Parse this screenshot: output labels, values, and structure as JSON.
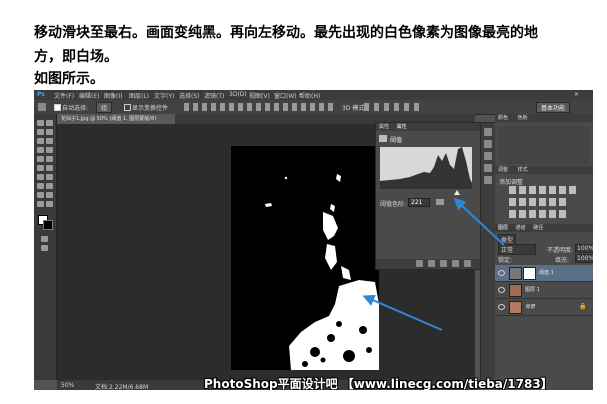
{
  "article": {
    "line1": "移动滑块至最右。画面变纯黑。再向左移动。最先出现的白色像素为图像最亮的地",
    "line2": "方，即白场。",
    "line3": "如图所示。"
  },
  "ps": {
    "logo": "Ps",
    "menus": [
      "文件(F)",
      "编辑(E)",
      "图像(I)",
      "图层(L)",
      "文字(Y)",
      "选择(S)",
      "滤镜(T)",
      "3D(D)",
      "视图(V)",
      "窗口(W)",
      "帮助(H)"
    ],
    "options": {
      "auto_select_label": "自动选择:",
      "auto_select_value": "组",
      "transform_label": "显示变换控件",
      "mode3d_label": "3D 模式:",
      "workspace": "基本功能"
    },
    "doc_tab": "花仙子1.jpg @ 50% (阈值 1, 图层蒙版/8)",
    "statusbar": {
      "zoom": "50%",
      "doc": "文档:2.22M/6.68M"
    },
    "properties": {
      "tabs": [
        "属性",
        "属性"
      ],
      "title": "阈值",
      "threshold_label": "阈值色阶:",
      "threshold_value": "221"
    },
    "right_top_tabs": [
      "颜色",
      "色板"
    ],
    "adjustments": {
      "tabs": [
        "调整",
        "样式"
      ],
      "title": "添加调整"
    },
    "layers": {
      "tabs": [
        "图层",
        "通道",
        "路径"
      ],
      "kind": "类型",
      "blend": "正常",
      "opacity_label": "不透明度:",
      "opacity": "100%",
      "fill_label": "填充:",
      "fill": "100%",
      "lock_label": "锁定:",
      "items": [
        {
          "name": "阈值 1",
          "selected": true
        },
        {
          "name": "图层 1",
          "selected": false
        },
        {
          "name": "背景",
          "selected": false
        }
      ]
    }
  },
  "watermark": "PhotoShop平面设计吧 【www.linecg.com/tieba/1783】",
  "colors": {
    "arrow": "#2f86d6",
    "panel": "#4a4a4a",
    "canvas": "#2c2c2c"
  }
}
